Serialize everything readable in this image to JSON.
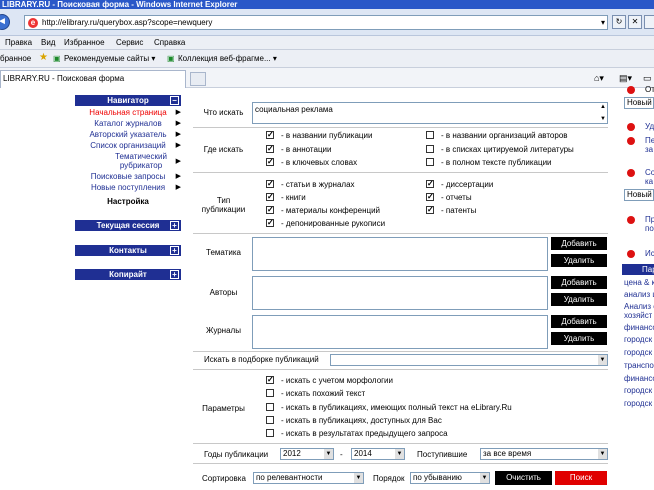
{
  "window": {
    "title": "LIBRARY.RU - Поисковая форма - Windows Internet Explorer"
  },
  "browser": {
    "address": "http://elibrary.ru/querybox.asp?scope=newquery",
    "menu": [
      "Правка",
      "Вид",
      "Избранное",
      "Сервис",
      "Справка"
    ],
    "menu_left_cut": "бранное",
    "links_left_cut": "бранное",
    "links": [
      "Рекомендуемые сайты ▾",
      "Коллекция веб-фрагме... ▾"
    ],
    "tab_title": "LIBRARY.RU - Поисковая форма"
  },
  "navigator": {
    "header": "Навигатор",
    "items": [
      "Начальная страница",
      "Каталог журналов",
      "Авторский указатель",
      "Список организаций",
      "Тематический рубрикатор",
      "Поисковые запросы",
      "Новые поступления"
    ],
    "settings": "Настройка",
    "session": "Текущая сессия",
    "contacts": "Контакты",
    "copyright": "Копирайт"
  },
  "form": {
    "what_label": "Что искать",
    "what_value": "социальная реклама",
    "where_label": "Где искать",
    "where_options": [
      {
        "label": "- в названии публикации",
        "checked": true
      },
      {
        "label": "- в названии организаций авторов",
        "checked": false
      },
      {
        "label": "- в аннотации",
        "checked": true
      },
      {
        "label": "- в списках цитируемой литературы",
        "checked": false
      },
      {
        "label": "- в ключевых словах",
        "checked": true
      },
      {
        "label": "- в полном тексте публикации",
        "checked": false
      }
    ],
    "type_label": "Тип публикации",
    "type_options": [
      {
        "label": "- статьи в журналах",
        "checked": true
      },
      {
        "label": "- диссертации",
        "checked": true
      },
      {
        "label": "- книги",
        "checked": true
      },
      {
        "label": "- отчеты",
        "checked": true
      },
      {
        "label": "- материалы конференций",
        "checked": true
      },
      {
        "label": "- патенты",
        "checked": true
      },
      {
        "label": "- депонированные рукописи",
        "checked": true
      }
    ],
    "topic_label": "Тематика",
    "authors_label": "Авторы",
    "journals_label": "Журналы",
    "add_btn": "Добавить",
    "del_btn": "Удалить",
    "collection_label": "Искать в подборке публикаций",
    "params_label": "Параметры",
    "params_options": [
      {
        "label": "- искать с учетом морфологии",
        "checked": true
      },
      {
        "label": "- искать похожий текст",
        "checked": false
      },
      {
        "label": "- искать в публикациях, имеющих полный текст на eLibrary.Ru",
        "checked": false
      },
      {
        "label": "- искать в публикациях, доступных для Вас",
        "checked": false
      },
      {
        "label": "- искать в результатах предыдущего запроса",
        "checked": false
      }
    ],
    "years_label": "Годы публикации",
    "year_from": "2012",
    "year_dash": "-",
    "year_to": "2014",
    "received_label": "Поступившие",
    "received_value": "за все время",
    "sort_label": "Сортировка",
    "sort_value": "по релевантности",
    "order_label": "Порядок",
    "order_value": "по убыванию",
    "clear_btn": "Очистить",
    "search_btn": "Поиск"
  },
  "right": {
    "top_text": "От",
    "select1": "Новый п",
    "t2": "Уд",
    "t3a": "Пе",
    "t3b": "за",
    "t4a": "Со",
    "t4b": "ка",
    "select2": "Новый",
    "t5a": "Пр",
    "t5b": "по",
    "t6": "Ис",
    "tags_header": "Пар",
    "tags": [
      "цена & к",
      "анализ ц",
      "Анализ о",
      "хозяйст",
      "финансо",
      "городск",
      "городск",
      "транспор",
      "финансо",
      "городск",
      "городск"
    ]
  },
  "colors": {
    "nav_blue": "#1f2f93",
    "accent_red": "#e00000",
    "title_blue": "#2a58c8"
  }
}
